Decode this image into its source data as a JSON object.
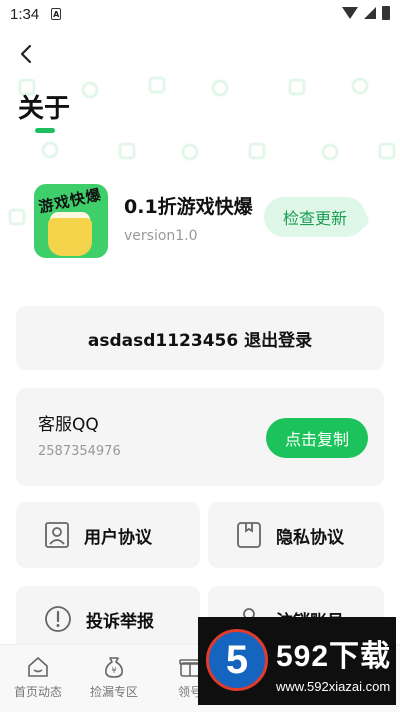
{
  "status": {
    "time": "1:34",
    "notification": "A"
  },
  "header": {
    "title": "关于"
  },
  "app": {
    "name": "0.1折游戏快爆",
    "version": "version1.0",
    "icon_text": "游戏快爆",
    "check_update": "检查更新"
  },
  "account": {
    "logout_label": "asdasd1123456 退出登录"
  },
  "support": {
    "title": "客服QQ",
    "qq_number": "2587354976",
    "copy_label": "点击复制"
  },
  "tiles": {
    "user_agreement": "用户协议",
    "privacy_agreement": "隐私协议",
    "report": "投诉举报",
    "cancel_account": "注销账号"
  },
  "tabbar": [
    {
      "label": "首页动态",
      "icon": "home-icon"
    },
    {
      "label": "捡漏专区",
      "icon": "money-bag-icon"
    },
    {
      "label": "领号",
      "icon": "gift-icon"
    }
  ],
  "watermark": {
    "title": "592下载",
    "url": "www.592xiazai.com",
    "badge": "5"
  },
  "colors": {
    "accent": "#1cc25b",
    "accent_light": "#dff7e8",
    "card_bg": "#f5f5f5"
  }
}
